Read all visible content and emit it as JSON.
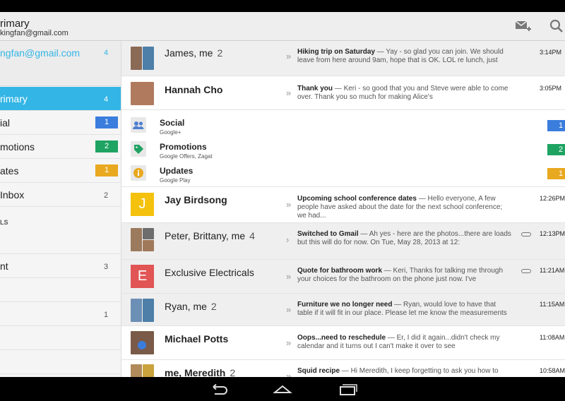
{
  "header": {
    "title": "rimary",
    "account": "kingfan@gmail.com",
    "compose_icon": "compose-icon",
    "search_icon": "search-icon"
  },
  "drawer": {
    "account_email": "ngfan@gmail.com",
    "account_count": "4",
    "items": [
      {
        "label": "rimary",
        "count": "4"
      },
      {
        "label": "ial",
        "count": "1",
        "color": "#3b7ddd"
      },
      {
        "label": "motions",
        "count": "2",
        "color": "#1ea362"
      },
      {
        "label": "ates",
        "count": "1",
        "color": "#e8a820"
      },
      {
        "label": "Inbox",
        "count": "2"
      },
      {
        "label": "",
        "count": ""
      },
      {
        "label": "nt",
        "count": "3"
      },
      {
        "label": "",
        "count": ""
      },
      {
        "label": "",
        "count": "1"
      }
    ],
    "section_label": "LS"
  },
  "messages": [
    {
      "sender": "James, me",
      "count": "2",
      "subject": "Hiking trip on Saturday",
      "snippet": " — Yay - so glad you can join. We should leave from here around 9am, hope that is OK. LOL re lunch, just",
      "time": "3:14PM",
      "unread": false
    },
    {
      "sender": "Hannah Cho",
      "count": "",
      "subject": "Thank you",
      "snippet": " — Keri - so good that you and Steve were able to come over. Thank you so much for making Alice's",
      "time": "3:05PM",
      "unread": true
    },
    {
      "sender": "Jay Birdsong",
      "count": "",
      "subject": "Upcoming school conference dates",
      "snippet": " — Hello everyone, A few people have asked about the date for the next school conference; we had...",
      "time": "12:26PM",
      "unread": true,
      "letter": "J",
      "letter_color": "#f4c20d"
    },
    {
      "sender": "Peter, Brittany, me",
      "count": "4",
      "subject": "Switched to Gmail",
      "snippet": " — Ah yes - here are the photos...there are loads but this will do for now. On Tue, May 28, 2013 at 12:",
      "time": "12:13PM",
      "unread": false
    },
    {
      "sender": "Exclusive Electricals",
      "count": "",
      "subject": "Quote for bathroom work",
      "snippet": " — Keri, Thanks for talking me through your choices for the bathroom on the phone just now. I've",
      "time": "11:21AM",
      "unread": false,
      "letter": "E",
      "letter_color": "#e15555"
    },
    {
      "sender": "Ryan, me",
      "count": "2",
      "subject": "Furniture we no longer need",
      "snippet": " — Ryan, would love to have that table if it will fit in our place. Please let me know the measurements",
      "time": "11:15AM",
      "unread": false
    },
    {
      "sender": "Michael Potts",
      "count": "",
      "subject": "Oops...need to reschedule",
      "snippet": " — Er, I did it again...didn't check my calendar and it turns out I can't make it over to see",
      "time": "11:08AM",
      "unread": true
    },
    {
      "sender": "me, Meredith",
      "count": "2",
      "subject": "Squid recipe",
      "snippet": " — Hi Meredith, I keep forgetting to ask you how to",
      "time": "10:58AM",
      "unread": true
    }
  ],
  "categories": [
    {
      "name": "Social",
      "sub": "Google+",
      "count": "1",
      "color": "#3b7ddd",
      "icon": "people-icon"
    },
    {
      "name": "Promotions",
      "sub": "Google Offers, Zagat",
      "count": "2",
      "color": "#1ea362",
      "icon": "tag-icon"
    },
    {
      "name": "Updates",
      "sub": "Google Play",
      "count": "1",
      "color": "#e8a820",
      "icon": "info-icon"
    }
  ],
  "nav": {
    "back_icon": "back-icon",
    "home_icon": "home-icon",
    "recents_icon": "recents-icon"
  }
}
